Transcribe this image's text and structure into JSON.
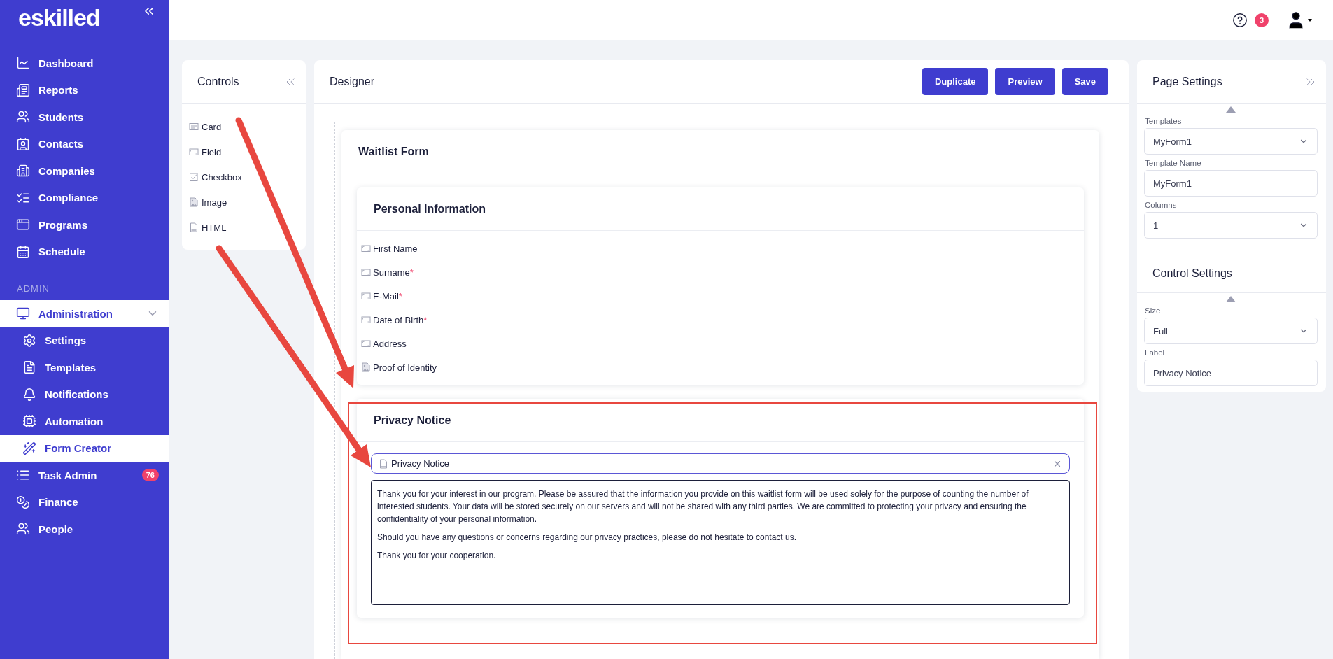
{
  "sidebar": {
    "logo": "eskilled",
    "sections": [
      {
        "items": [
          {
            "label": "Dashboard",
            "selected": false
          },
          {
            "label": "Reports",
            "selected": false
          },
          {
            "label": "Students",
            "selected": false
          },
          {
            "label": "Contacts",
            "selected": false
          },
          {
            "label": "Companies",
            "selected": false
          },
          {
            "label": "Compliance",
            "selected": false
          },
          {
            "label": "Programs",
            "selected": false
          },
          {
            "label": "Schedule",
            "selected": false
          }
        ]
      },
      {
        "title": "ADMIN",
        "items": [
          {
            "label": "Administration",
            "selected": true,
            "expanded": true,
            "children": [
              {
                "label": "Settings",
                "selected": false
              },
              {
                "label": "Templates",
                "selected": false
              },
              {
                "label": "Notifications",
                "selected": false
              },
              {
                "label": "Automation",
                "selected": false
              },
              {
                "label": "Form Creator",
                "selected": true
              }
            ]
          },
          {
            "label": "Task Admin",
            "selected": false,
            "badge": "76"
          },
          {
            "label": "Finance",
            "selected": false
          },
          {
            "label": "People",
            "selected": false
          }
        ]
      }
    ]
  },
  "topbar": {
    "notification_count": "3"
  },
  "controls": {
    "title": "Controls",
    "items": [
      {
        "label": "Card",
        "kind": "card"
      },
      {
        "label": "Field",
        "kind": "field"
      },
      {
        "label": "Checkbox",
        "kind": "checkbox"
      },
      {
        "label": "Image",
        "kind": "image"
      },
      {
        "label": "HTML",
        "kind": "html"
      }
    ]
  },
  "designer": {
    "title": "Designer",
    "buttons": [
      "Duplicate",
      "Preview",
      "Save"
    ],
    "form": {
      "title": "Waitlist Form",
      "cards": [
        {
          "title": "Personal Information",
          "fields": [
            {
              "label": "First Name",
              "kind": "field"
            },
            {
              "label": "Surname",
              "kind": "field",
              "mark": "*"
            },
            {
              "label": "E-Mail",
              "kind": "field",
              "mark": "*"
            },
            {
              "label": "Date of Birth",
              "kind": "field",
              "mark": "*"
            },
            {
              "label": "Address",
              "kind": "field"
            },
            {
              "label": "Proof of Identity",
              "kind": "image"
            }
          ]
        },
        {
          "title": "Privacy Notice",
          "control": {
            "kind": "html",
            "label": "Privacy Notice",
            "selected": true,
            "paragraphs": [
              "Thank you for your interest in our program. Please be assured that the information you provide on this waitlist form will be used solely for the purpose of counting the number of interested students. Your data will be stored securely on our servers and will not be shared with any third parties. We are committed to protecting your privacy and ensuring the confidentiality of your personal information.",
              "Should you have any questions or concerns regarding our privacy practices, please do not hesitate to contact us.",
              "Thank you for your cooperation."
            ]
          }
        }
      ]
    }
  },
  "settings": {
    "sections": [
      {
        "title": "Page Settings",
        "fields": [
          {
            "label": "Templates",
            "kind": "select",
            "value": "MyForm1"
          },
          {
            "label": "Template Name",
            "kind": "input",
            "value": "MyForm1"
          },
          {
            "label": "Columns",
            "kind": "select",
            "value": "1"
          }
        ]
      },
      {
        "title": "Control Settings",
        "fields": [
          {
            "label": "Size",
            "kind": "select",
            "value": "Full"
          },
          {
            "label": "Label",
            "kind": "input",
            "value": "Privacy Notice"
          }
        ]
      }
    ]
  }
}
